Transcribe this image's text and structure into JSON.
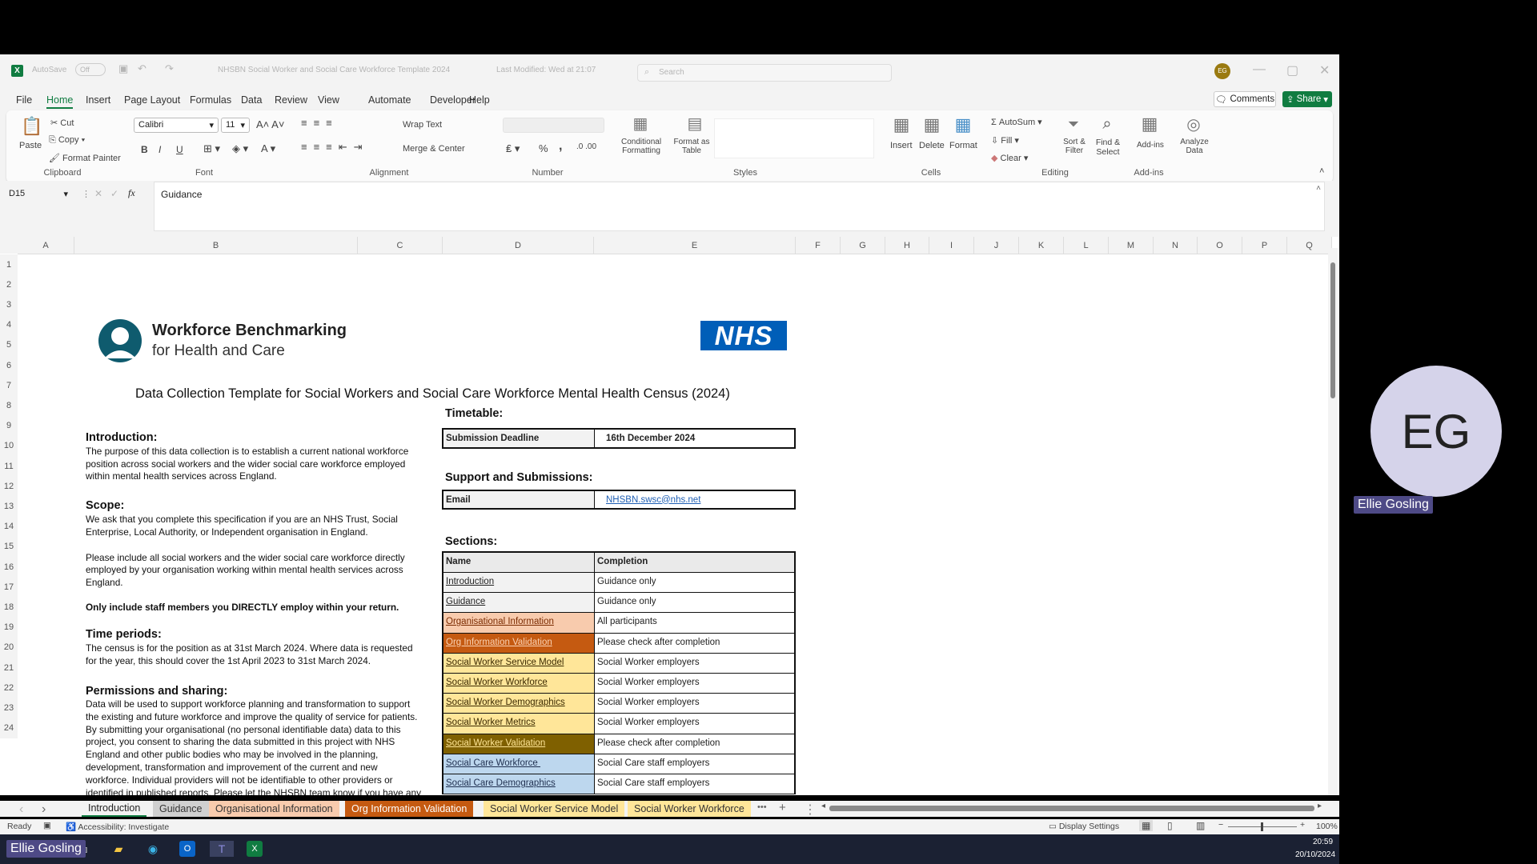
{
  "titlebar": {
    "autosave_label": "AutoSave",
    "autosave_state": "Off",
    "document_title": "NHSBN Social Worker and Social Care Workforce Template 2024",
    "last_modified": "Last Modified: Wed at 21:07",
    "search_placeholder": "Search",
    "user_initials": "EG"
  },
  "menu": [
    "File",
    "Home",
    "Insert",
    "Page Layout",
    "Formulas",
    "Data",
    "Review",
    "View",
    "Automate",
    "Developer",
    "Help"
  ],
  "menu_active": "Home",
  "buttons": {
    "comments": "Comments",
    "share": "Share"
  },
  "ribbon": {
    "clipboard": {
      "paste": "Paste",
      "cut": "Cut",
      "copy": "Copy",
      "format_painter": "Format Painter",
      "label": "Clipboard"
    },
    "font": {
      "name": "Calibri",
      "size": "11",
      "label": "Font",
      "bold": "B",
      "italic": "I",
      "underline": "U"
    },
    "alignment": {
      "wrap_text": "Wrap Text",
      "merge_center": "Merge & Center",
      "label": "Alignment"
    },
    "number": {
      "format": "",
      "label": "Number",
      "percent": "%",
      "comma": ","
    },
    "styles": {
      "conditional_formatting": "Conditional Formatting",
      "format_as_table": "Format as Table",
      "label": "Styles"
    },
    "cells": {
      "insert": "Insert",
      "delete": "Delete",
      "format": "Format",
      "label": "Cells"
    },
    "editing": {
      "autosum": "AutoSum",
      "fill": "Fill",
      "clear": "Clear",
      "sort_filter": "Sort & Filter",
      "find_select": "Find & Select",
      "label": "Editing"
    },
    "addins": {
      "addins": "Add-ins",
      "analyze_data": "Analyze Data",
      "label": "Add-ins"
    }
  },
  "formula_bar": {
    "cell_ref": "D15",
    "fx": "fx",
    "content": "Guidance"
  },
  "columns": [
    "A",
    "B",
    "C",
    "D",
    "E",
    "F",
    "G",
    "H",
    "I",
    "J",
    "K",
    "L",
    "M",
    "N",
    "O",
    "P",
    "Q"
  ],
  "rows": [
    "1",
    "2",
    "3",
    "4",
    "5",
    "6",
    "7",
    "8",
    "9",
    "10",
    "11",
    "12",
    "13",
    "14",
    "15",
    "16",
    "17",
    "18",
    "19",
    "20",
    "21",
    "22",
    "23",
    "24"
  ],
  "sheet": {
    "logo_line1": "Workforce Benchmarking",
    "logo_line2": "for Health and Care",
    "nhs_logo": "NHS",
    "title": "Data Collection Template for Social Workers and Social Care Workforce Mental Health Census (2024)",
    "introduction": {
      "heading": "Introduction:",
      "lines": [
        "The purpose of this data collection is to establish a current national workforce",
        "position across social workers and the wider social care workforce employed",
        "within mental health services across England."
      ]
    },
    "scope": {
      "heading": "Scope:",
      "lines": [
        "We ask that you complete this specification if you are an NHS Trust, Social",
        "Enterprise, Local Authority, or Independent organisation in England."
      ],
      "lines2": [
        "Please include all social workers and the wider social care workforce directly",
        "employed by your organisation working within mental health services across",
        "England."
      ],
      "bold_note": "Only include staff members you DIRECTLY employ within your return."
    },
    "time_periods": {
      "heading": "Time periods:",
      "lines": [
        "The census is for the position as at 31st March 2024. Where data is requested",
        "for the year, this should cover the 1st April 2023 to 31st March 2024."
      ]
    },
    "permissions": {
      "heading": "Permissions and sharing:",
      "lines": [
        "Data will be used to support workforce planning and transformation to support",
        "the existing and future workforce and improve the quality of service for patients.",
        "By submitting your organisational (no personal identifiable data) data to this",
        "project, you consent to sharing the data submitted in this project with NHS",
        "England and other public bodies who may be involved in the planning,",
        "development, transformation and improvement of the current and new",
        "workforce. Individual providers will not be identifiable to other providers or",
        "identified in published reports. Please let the NHSBN team know if you have any"
      ]
    },
    "timetable": {
      "heading": "Timetable:",
      "label": "Submission Deadline",
      "value": "16th December 2024"
    },
    "support": {
      "heading": "Support and Submissions:",
      "label": "Email",
      "value": "NHSBN.swsc@nhs.net"
    },
    "sections": {
      "heading": "Sections:",
      "col_name": "Name",
      "col_completion": "Completion",
      "rows": [
        {
          "name": "Introduction",
          "completion": "Guidance only",
          "bg": "#f2f2f2",
          "fg": "#1f1f1f"
        },
        {
          "name": "Guidance",
          "completion": "Guidance only",
          "bg": "#f2f2f2",
          "fg": "#1f1f1f"
        },
        {
          "name": "Organisational Information",
          "completion": "All participants",
          "bg": "#f8cbad",
          "fg": "#7a2a00"
        },
        {
          "name": "Org Information Validation",
          "completion": "Please check after completion",
          "bg": "#c55a11",
          "fg": "#fbd3b5"
        },
        {
          "name": "Social Worker Service Model",
          "completion": "Social Worker employers",
          "bg": "#ffe699",
          "fg": "#3a2a00"
        },
        {
          "name": "Social Worker Workforce",
          "completion": "Social Worker employers",
          "bg": "#ffe699",
          "fg": "#3a2a00"
        },
        {
          "name": "Social Worker Demographics",
          "completion": "Social Worker employers",
          "bg": "#ffe699",
          "fg": "#3a2a00"
        },
        {
          "name": "Social Worker Metrics",
          "completion": "Social Worker employers",
          "bg": "#ffe699",
          "fg": "#3a2a00"
        },
        {
          "name": "Social Worker Validation",
          "completion": "Please check after completion",
          "bg": "#7f6000",
          "fg": "#ffe699"
        },
        {
          "name": "Social Care Workforce ",
          "completion": "Social Care staff employers",
          "bg": "#bdd7ee",
          "fg": "#1f2f4f"
        },
        {
          "name": "Social Care Demographics",
          "completion": "Social Care staff employers",
          "bg": "#bdd7ee",
          "fg": "#1f2f4f"
        }
      ]
    }
  },
  "sheet_tabs": [
    {
      "label": "Introduction",
      "bg": "#f3f3f3",
      "fg": "#222",
      "active": true
    },
    {
      "label": "Guidance",
      "bg": "#d0d0d0",
      "fg": "#333"
    },
    {
      "label": "Organisational Information",
      "bg": "#f8cbad",
      "fg": "#333"
    },
    {
      "label": "Org Information Validation",
      "bg": "#c55a11",
      "fg": "#fff"
    },
    {
      "label": "Social Worker Service Model",
      "bg": "#ffe699",
      "fg": "#333"
    },
    {
      "label": "Social Worker Workforce",
      "bg": "#ffe699",
      "fg": "#333"
    }
  ],
  "status": {
    "ready": "Ready",
    "accessibility": "Accessibility: Investigate",
    "display_settings": "Display Settings",
    "zoom": "100%",
    "zoom_value": 100
  },
  "taskbar": {
    "time": "20:59",
    "date": "20/10/2024"
  },
  "participant": {
    "initials": "EG",
    "name": "Ellie Gosling",
    "self_label": "Ellie Gosling"
  },
  "colors": {
    "excel_green": "#107c41",
    "avatar_bg": "#d5d3ea",
    "name_label_bg": "#4e4a86"
  }
}
